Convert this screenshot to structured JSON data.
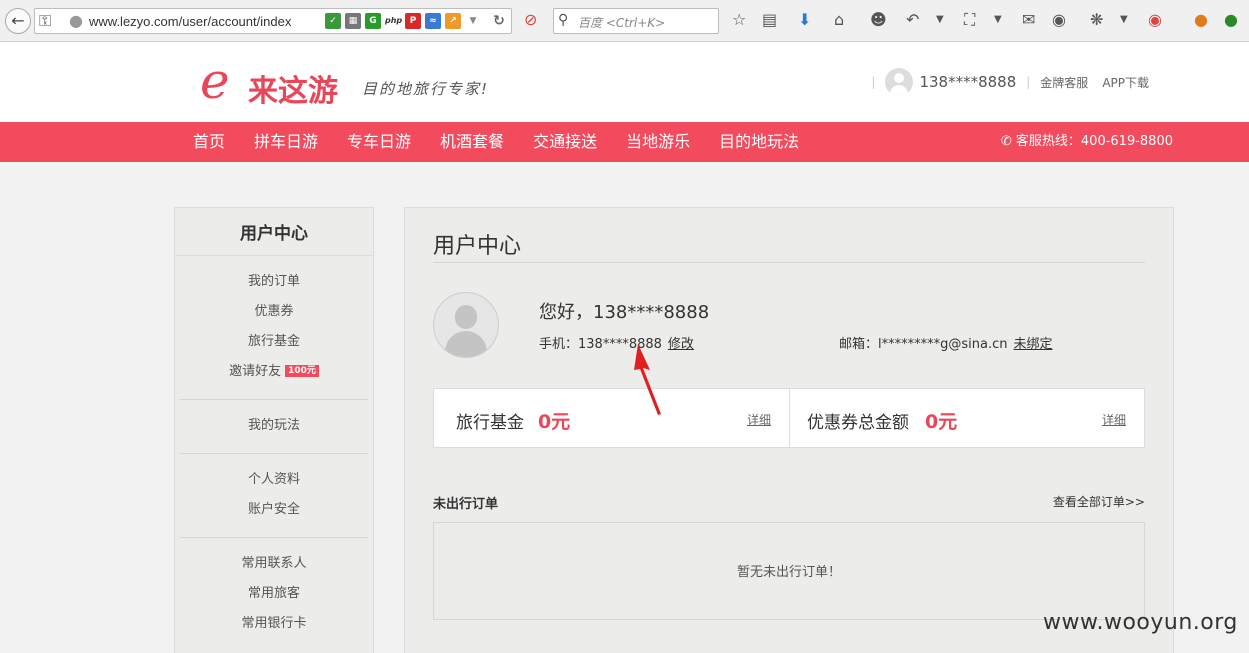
{
  "browser": {
    "url": "www.lezyo.com/user/account/index",
    "search_placeholder": "百度 <Ctrl+K>"
  },
  "header": {
    "logo_mark": "e",
    "logo_name": "来这游",
    "slogan": "目的地旅行专家!",
    "user": "138****8888",
    "links": [
      "金牌客服",
      "APP下载"
    ]
  },
  "nav": {
    "items": [
      "首页",
      "拼车日游",
      "专车日游",
      "机酒套餐",
      "交通接送",
      "当地游乐",
      "目的地玩法"
    ],
    "hotline": "客服热线：400-619-8800"
  },
  "sidebar": {
    "title": "用户中心",
    "groups": [
      [
        {
          "label": "我的订单"
        },
        {
          "label": "优惠券"
        },
        {
          "label": "旅行基金"
        },
        {
          "label": "邀请好友",
          "badge": "100元"
        }
      ],
      [
        {
          "label": "我的玩法"
        }
      ],
      [
        {
          "label": "个人资料"
        },
        {
          "label": "账户安全"
        }
      ],
      [
        {
          "label": "常用联系人"
        },
        {
          "label": "常用旅客"
        },
        {
          "label": "常用银行卡"
        }
      ]
    ]
  },
  "main": {
    "title": "用户中心",
    "greeting": "您好，138****8888",
    "phone_label": "手机：",
    "phone": "138****8888",
    "phone_action": "修改",
    "email_label": "邮箱：",
    "email": "l*********g@sina.cn",
    "email_action": "未绑定",
    "funds": [
      {
        "label": "旅行基金",
        "value": "0元",
        "detail": "详细"
      },
      {
        "label": "优惠券总金额",
        "value": "0元",
        "detail": "详细"
      }
    ],
    "orders_title": "未出行订单",
    "orders_all": "查看全部订单>>",
    "orders_empty": "暂无未出行订单！"
  },
  "watermark": "www.wooyun.org",
  "colors": {
    "brand": "#f24b5e",
    "accent_text": "#e8475a"
  }
}
